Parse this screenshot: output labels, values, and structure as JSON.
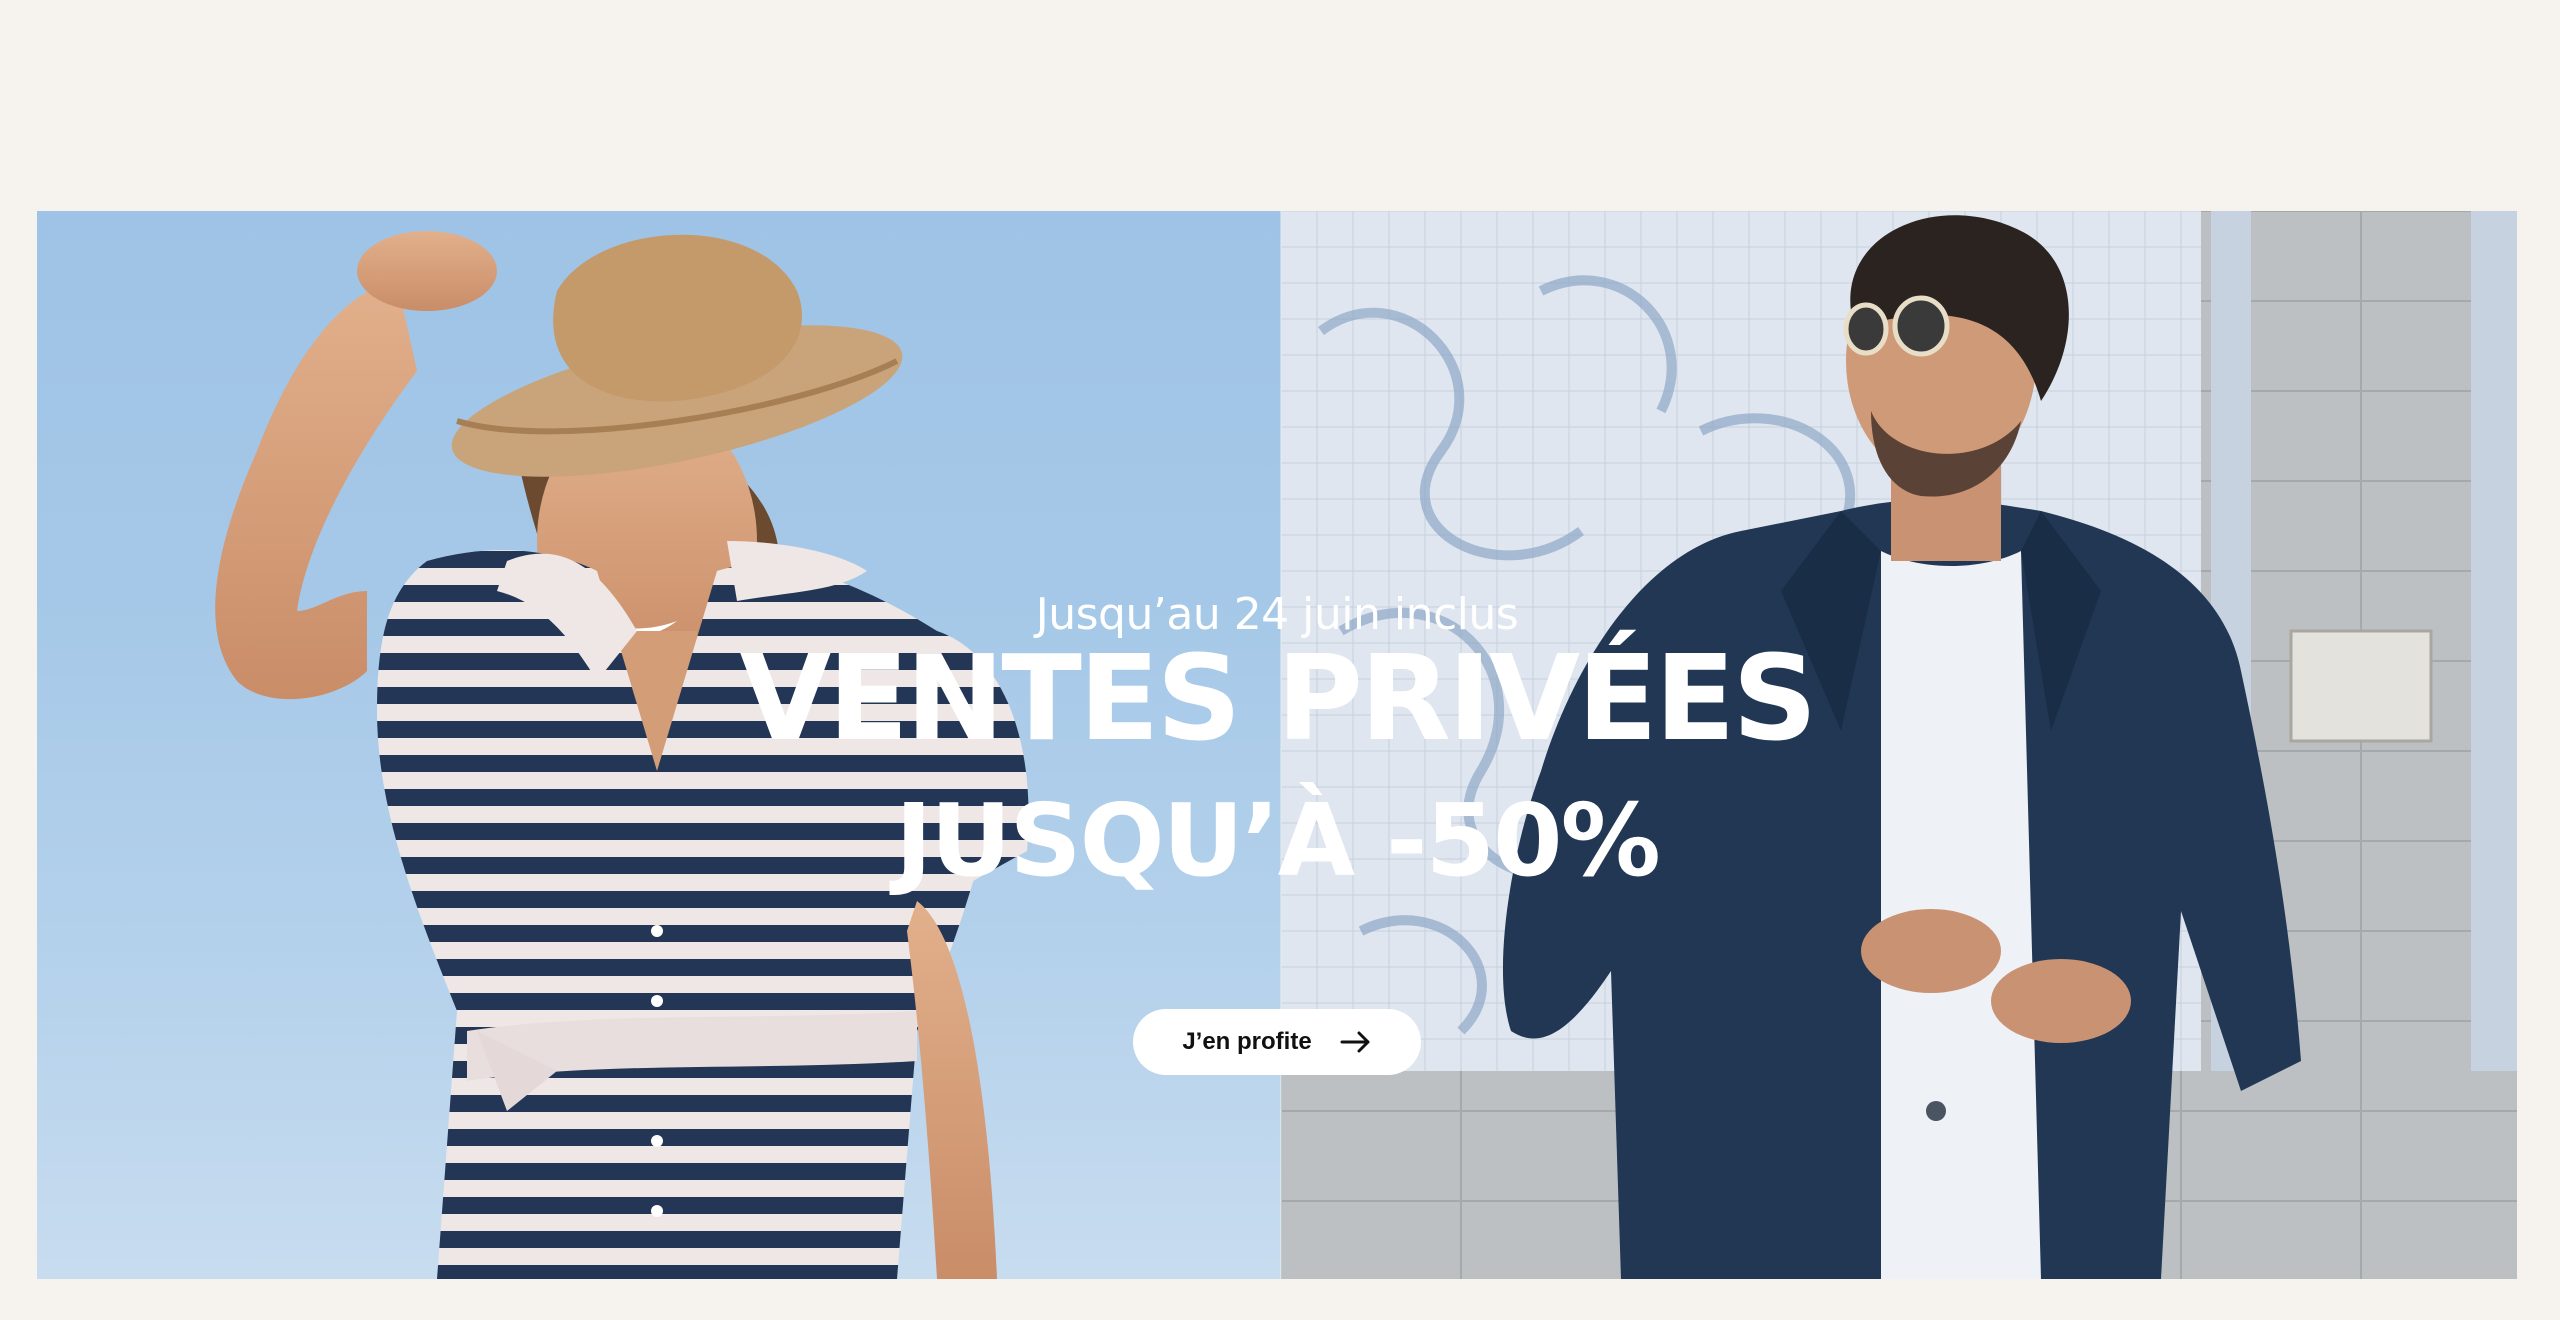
{
  "hero": {
    "subtitle": "Jusqu’au 24 juin inclus",
    "headline": "VENTES PRIVÉES",
    "discount": "JUSQU’À -50%",
    "cta_label": "J’en profite",
    "cta_icon": "arrow-right-icon",
    "left_image": "woman-striped-dress-straw-hat-photo",
    "right_image": "man-navy-blazer-sunglasses-photo"
  },
  "colors": {
    "page_background": "#f6f3ee",
    "text": "#ffffff",
    "button_background": "#ffffff",
    "button_text": "#111111",
    "navy": "#1f3452",
    "sky": "#a7c9e8"
  }
}
